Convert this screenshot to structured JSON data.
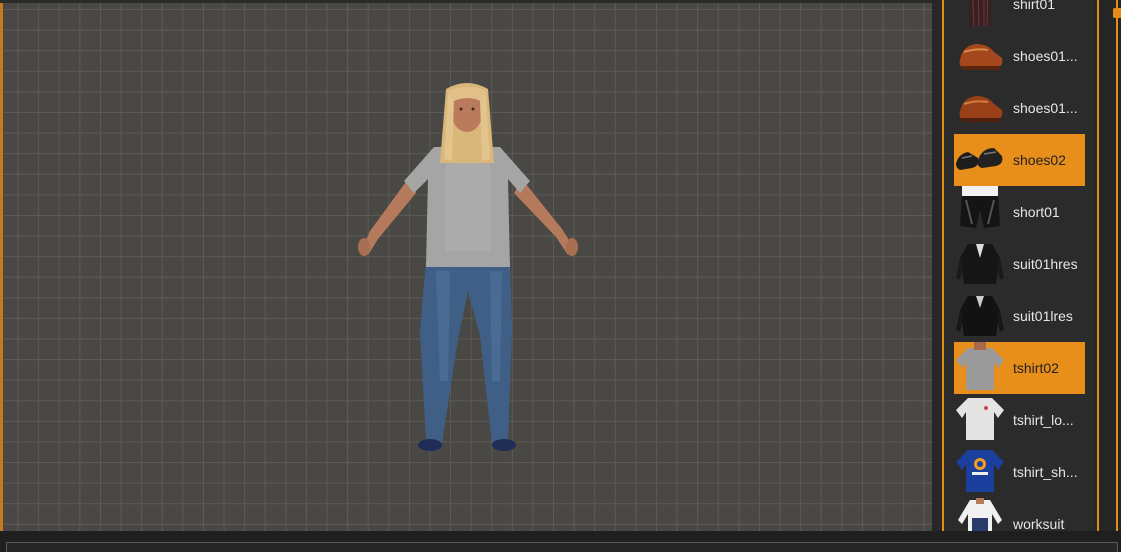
{
  "viewport": {
    "model_description_icon": "human-figure-avatar"
  },
  "sidebar": {
    "items": [
      {
        "label": "shirt01",
        "icon": "shirt-thumbnail-icon",
        "selected": false
      },
      {
        "label": "shoes01...",
        "icon": "brown-shoe-thumbnail-icon",
        "selected": false
      },
      {
        "label": "shoes01...",
        "icon": "brown-shoe-thumbnail-icon",
        "selected": false
      },
      {
        "label": "shoes02",
        "icon": "black-shoes-thumbnail-icon",
        "selected": true
      },
      {
        "label": "short01",
        "icon": "shorts-thumbnail-icon",
        "selected": false
      },
      {
        "label": "suit01hres",
        "icon": "suit-thumbnail-icon",
        "selected": false
      },
      {
        "label": "suit01lres",
        "icon": "suit-thumbnail-icon",
        "selected": false
      },
      {
        "label": "tshirt02",
        "icon": "tshirt-thumbnail-icon",
        "selected": true
      },
      {
        "label": "tshirt_lo...",
        "icon": "white-tshirt-thumbnail-icon",
        "selected": false
      },
      {
        "label": "tshirt_sh...",
        "icon": "blue-tshirt-thumbnail-icon",
        "selected": false
      },
      {
        "label": "worksuit",
        "icon": "worksuit-thumbnail-icon",
        "selected": false
      }
    ]
  },
  "colors": {
    "accent": "#e88e1b",
    "panel": "#2b2b2b",
    "grid_bg": "#4a4844"
  }
}
